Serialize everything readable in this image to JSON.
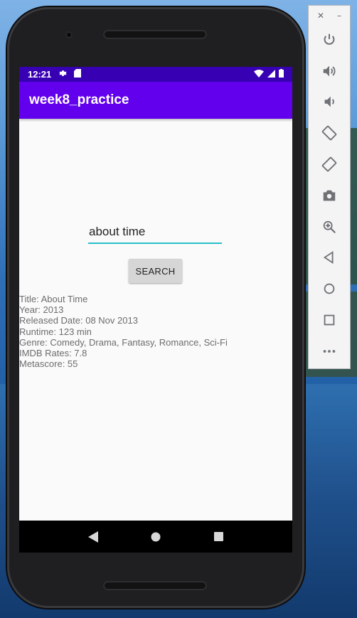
{
  "statusBar": {
    "time": "12:21"
  },
  "appBar": {
    "title": "week8_practice"
  },
  "search": {
    "value": "about time"
  },
  "button": {
    "label": "SEARCH"
  },
  "movie": {
    "title": "Title: About Time",
    "year": "Year: 2013",
    "released": "Released Date: 08 Nov 2013",
    "runtime": "Runtime: 123 min",
    "genre": "Genre: Comedy, Drama, Fantasy, Romance, Sci-Fi",
    "imdb": "IMDB Rates: 7.8",
    "metascore": "Metascore: 55"
  },
  "toolbar": {
    "items": [
      "power-icon",
      "volume-up-icon",
      "volume-down-icon",
      "rotate-left-icon",
      "rotate-right-icon",
      "camera-icon",
      "zoom-icon",
      "back-icon",
      "home-icon",
      "overview-icon",
      "more-icon"
    ]
  },
  "colors": {
    "statusBar": "#3700b3",
    "appBar": "#6200ee",
    "inputUnderline": "#26bfc9"
  }
}
